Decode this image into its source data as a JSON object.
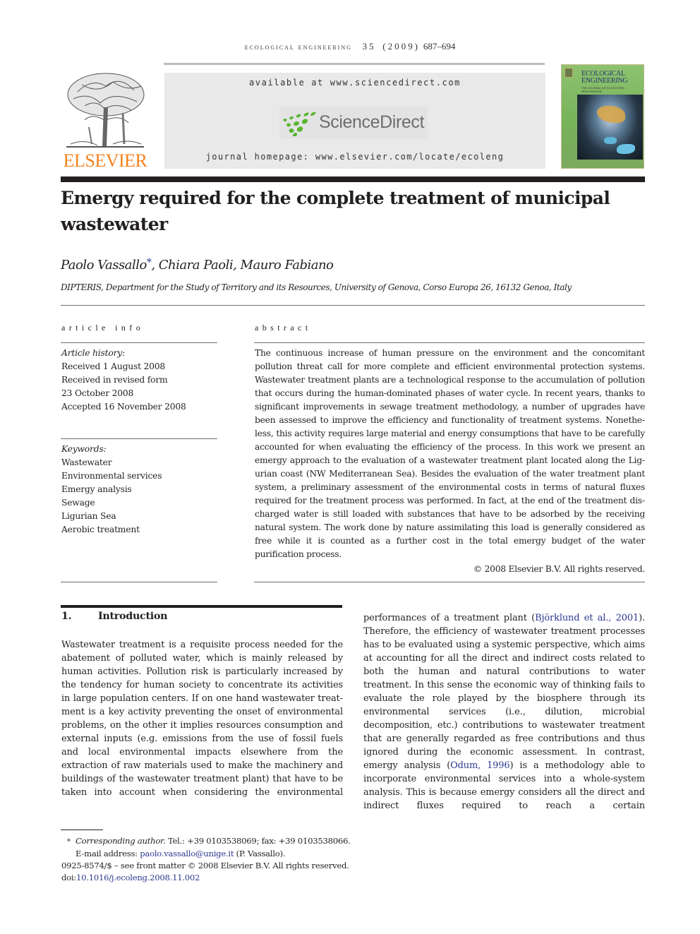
{
  "running_header": {
    "journal": "ecological engineering",
    "volume": "35",
    "year": "(2009)",
    "pages": "687–694"
  },
  "banner": {
    "publisher_logo": "ELSEVIER",
    "available_at": "available at www.sciencedirect.com",
    "sciencedirect_logo": "ScienceDirect",
    "homepage": "journal homepage: www.elsevier.com/locate/ecoleng",
    "cover": {
      "title_line1": "ECOLOGICAL",
      "title_line2": "ENGINEERING",
      "subtitle": "THE JOURNAL OF ECOSYSTEM RESTORATION"
    },
    "colors": {
      "elsevier_orange": "#f58220",
      "sciencedirect_green": "#5cb531",
      "sciencedirect_gray": "#6c6e70",
      "banner_bg": "#e9e9ea",
      "link_blue": "#2b3990"
    }
  },
  "article": {
    "title": "Emergy required for the complete treatment of municipal wastewater",
    "authors": [
      {
        "name": "Paolo Vassallo",
        "corresponding": true,
        "marker": "*"
      },
      {
        "name": "Chiara Paoli",
        "corresponding": false
      },
      {
        "name": "Mauro Fabiano",
        "corresponding": false
      }
    ],
    "affiliation": "DIPTERIS, Department for the Study of Territory and its Resources, University of Genova, Corso Europa 26, 16132 Genoa, Italy"
  },
  "article_info": {
    "heading": "article info",
    "history_label": "Article history:",
    "history": [
      "Received 1 August 2008",
      "Received in revised form",
      "23 October 2008",
      "Accepted 16 November 2008"
    ],
    "keywords_label": "Keywords:",
    "keywords": [
      "Wastewater",
      "Environmental services",
      "Emergy analysis",
      "Sewage",
      "Ligurian Sea",
      "Aerobic treatment"
    ]
  },
  "abstract": {
    "heading": "abstract",
    "text": "The continuous increase of human pressure on the environment and the concomitant pollution threat call for more complete and efficient environmental protection systems. Wastewater treatment plants are a technological response to the accumulation of pollution that occurs during the human-dominated phases of water cycle. In recent years, thanks to significant improvements in sewage treatment methodology, a number of upgrades have been assessed to improve the efficiency and functionality of treatment systems. Nonethe­less, this activity requires large material and energy consumptions that have to be carefully accounted for when evaluating the efficiency of the process. In this work we present an emergy approach to the evaluation of a wastewater treatment plant located along the Lig­urian coast (NW Mediterranean Sea). Besides the evaluation of the water treatment plant system, a preliminary assessment of the environmental costs in terms of natural fluxes required for the treatment process was performed. In fact, at the end of the treatment dis­charged water is still loaded with substances that have to be adsorbed by the receiving natural system. The work done by nature assimilating this load is generally considered as free while it is counted as a further cost in the total emergy budget of the water purification process.",
    "copyright": "© 2008 Elsevier B.V. All rights reserved."
  },
  "introduction": {
    "number": "1.",
    "title": "Introduction",
    "left_column": "Wastewater treatment is a requisite process needed for the abatement of polluted water, which is mainly released by human activities. Pollution risk is particularly increased by the tendency for human society to concentrate its activities in large population centers. If on one hand wastewater treat­ment is a key activity preventing the onset of environmental problems, on the other it implies resources consumption and external inputs (e.g. emissions from the use of fossil fuels and local environmental impacts elsewhere from the extraction of raw materials used to make the machinery and buildings of the wastewater treatment plant) that have to be taken into account when considering the environmental",
    "right_column": {
      "part1": "performances of a treatment plant (",
      "cite1": "Björklund et al., 2001",
      "part2": "). Therefore, the efficiency of wastewater treatment processes has to be evaluated using a systemic perspective, which aims at accounting for all the direct and indirect costs related to both the human and natural contributions to water treatment. In this sense the economic way of thinking fails to evaluate the role played by the biosphere through its environmental services (i.e., dilution, microbial decomposition, etc.) contri­butions to wastewater treatment that are generally regarded as free contributions and thus ignored during the economic assessment. In contrast, emergy analysis (",
      "cite2": "Odum, 1996",
      "part3": ") is a methodology able to incorporate environmental services into a whole-system analysis. This is because emergy considers all the direct and indirect fluxes required to reach a certain"
    }
  },
  "footnotes": {
    "marker": "*",
    "corresponding_label": "Corresponding author.",
    "contact": " Tel.: +39 0103538069; fax: +39 0103538066.",
    "email_label": "E-mail address: ",
    "email": "paolo.vassallo@unige.it",
    "email_suffix": " (P. Vassallo).",
    "front_matter": "0925-8574/$ – see front matter © 2008 Elsevier B.V. All rights reserved.",
    "doi_label": "doi:",
    "doi": "10.1016/j.ecoleng.2008.11.002"
  }
}
